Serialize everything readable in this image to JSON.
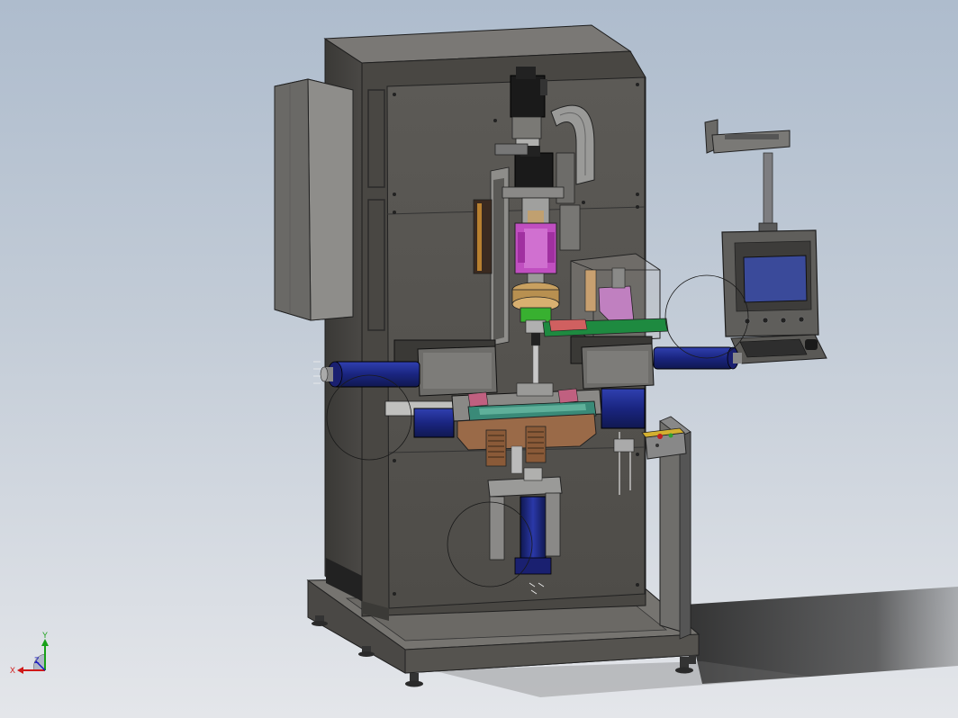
{
  "viewport": {
    "background_top": "#aebccd",
    "background_bottom": "#e4e6ea"
  },
  "colors": {
    "frame_dark": "#3f3d3a",
    "frame_mid": "#5a5854",
    "frame_light": "#6e6c68",
    "panel_gray": "#8a8a88",
    "cylinder_blue": "#1e2a8a",
    "motor_black": "#1a1a1a",
    "clamp_magenta": "#c04fc0",
    "ring_green": "#38b030",
    "ring_orange": "#c8a060",
    "fixture_teal": "#3a8a78",
    "support_brown": "#9a6a48",
    "screen_blue": "#3a4a9a",
    "axis_x": "#d01818",
    "axis_y": "#18a018"
  },
  "components": {
    "cabinet": "electrical-cabinet",
    "frame": "machine-frame",
    "base": "base-plate",
    "feet": "leveling-feet",
    "hmi": "touch-panel-hmi",
    "keyboard": "keyboard-tray",
    "monitor_arm": "monitor-arm",
    "control_stand": "control-stand",
    "control_box": "push-button-box",
    "spindle_motors": "servo-motors",
    "cylinders": "pneumatic-cylinders",
    "fixture": "workpiece-fixture",
    "guard": "transparent-guard",
    "reference_circles": "sketch-circles"
  },
  "triad": {
    "x_label": "X",
    "y_label": "Y",
    "z_label": "Z"
  }
}
